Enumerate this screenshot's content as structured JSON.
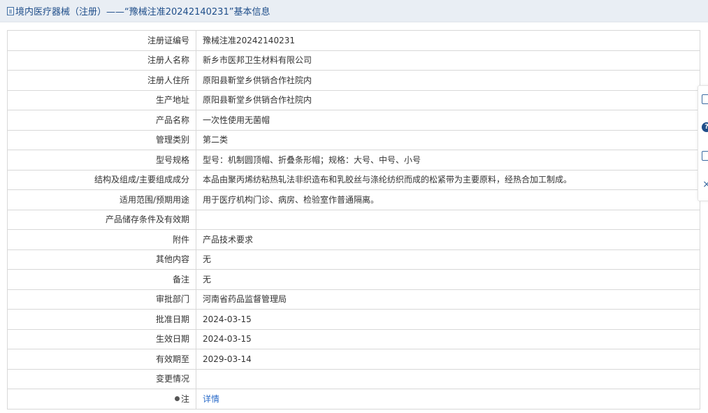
{
  "header": {
    "title": "境内医疗器械（注册）——“豫械注准20242140231”基本信息"
  },
  "rows": [
    {
      "label": "注册证编号",
      "value": "豫械注准20242140231"
    },
    {
      "label": "注册人名称",
      "value": "新乡市医邦卫生材料有限公司"
    },
    {
      "label": "注册人住所",
      "value": "原阳县靳堂乡供销合作社院内"
    },
    {
      "label": "生产地址",
      "value": "原阳县靳堂乡供销合作社院内"
    },
    {
      "label": "产品名称",
      "value": "一次性使用无菌帽"
    },
    {
      "label": "管理类别",
      "value": "第二类"
    },
    {
      "label": "型号规格",
      "value": "型号：机制圆顶帽、折叠条形帽；规格：大号、中号、小号"
    },
    {
      "label": "结构及组成/主要组成成分",
      "value": "本品由聚丙烯纺粘热轧法非织造布和乳胶丝与涤纶纺织而成的松紧带为主要原料，经热合加工制成。"
    },
    {
      "label": "适用范围/预期用途",
      "value": "用于医疗机构门诊、病房、检验室作普通隔离。"
    },
    {
      "label": "产品储存条件及有效期",
      "value": ""
    },
    {
      "label": "附件",
      "value": "产品技术要求"
    },
    {
      "label": "其他内容",
      "value": "无"
    },
    {
      "label": "备注",
      "value": "无"
    },
    {
      "label": "审批部门",
      "value": "河南省药品监督管理局"
    },
    {
      "label": "批准日期",
      "value": "2024-03-15"
    },
    {
      "label": "生效日期",
      "value": "2024-03-15"
    },
    {
      "label": "有效期至",
      "value": "2029-03-14"
    },
    {
      "label": "变更情况",
      "value": ""
    }
  ],
  "note_row": {
    "label": "注",
    "link": "详情",
    "icon": "pin-icon"
  },
  "sidebar": {
    "help_glyph": "?",
    "close_glyph": "×"
  }
}
